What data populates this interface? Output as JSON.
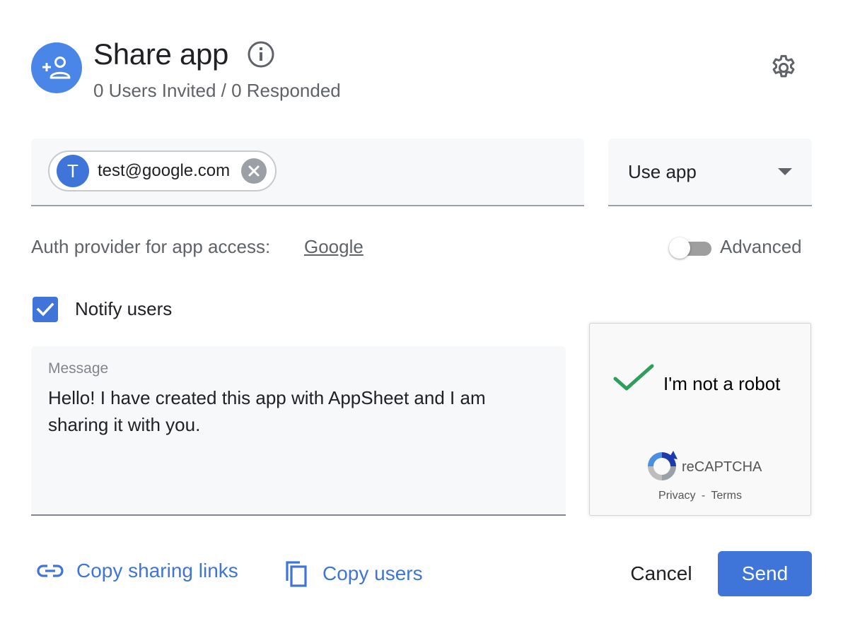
{
  "header": {
    "avatar_icon": "person-add-icon",
    "title": "Share app",
    "info_icon": "info-icon",
    "subtitle": "0 Users Invited / 0 Responded",
    "settings_icon": "gear-icon"
  },
  "invite": {
    "chip": {
      "initial": "T",
      "email": "test@google.com",
      "remove_icon": "close-icon"
    },
    "role": {
      "selected": "Use app",
      "arrow_icon": "arrow-drop-down-icon"
    }
  },
  "auth": {
    "label": "Auth provider for app access:",
    "provider": "Google"
  },
  "advanced": {
    "label": "Advanced",
    "enabled": false
  },
  "notify": {
    "label": "Notify users",
    "checked": true
  },
  "message": {
    "caption": "Message",
    "text": "Hello! I have created this app with AppSheet and I am sharing it with you."
  },
  "recaptcha": {
    "label": "I'm not a robot",
    "brand": "reCAPTCHA",
    "privacy": "Privacy",
    "separator": "-",
    "terms": "Terms",
    "verified": true
  },
  "footer": {
    "copy_links_label": "Copy sharing links",
    "copy_links_icon": "link-icon",
    "copy_users_label": "Copy users",
    "copy_users_icon": "copy-icon",
    "cancel_label": "Cancel",
    "send_label": "Send"
  },
  "colors": {
    "accent": "#3f74d9",
    "avatar": "#4a86e8",
    "text_primary": "#202124",
    "text_secondary": "#5f6368",
    "recaptcha_check": "#2e9e5b"
  }
}
